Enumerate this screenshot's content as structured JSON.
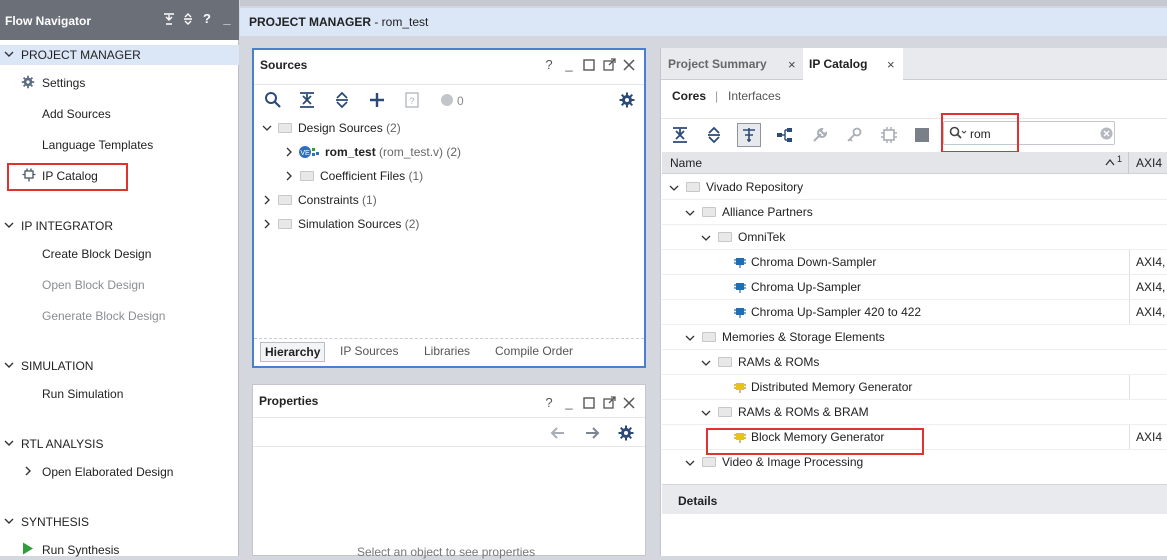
{
  "flow_navigator": {
    "title": "Flow Navigator",
    "header_icons": [
      "collapse-all-icon",
      "expand-all-icon",
      "help-icon",
      "minimize-icon"
    ],
    "sections": {
      "project_manager": {
        "label": "PROJECT MANAGER",
        "items": [
          "Settings",
          "Add Sources",
          "Language Templates",
          "IP Catalog"
        ]
      },
      "ip_integrator": {
        "label": "IP INTEGRATOR",
        "items": [
          "Create Block Design",
          "Open Block Design",
          "Generate Block Design"
        ]
      },
      "simulation": {
        "label": "SIMULATION",
        "items": [
          "Run Simulation"
        ]
      },
      "rtl_analysis": {
        "label": "RTL ANALYSIS",
        "items": [
          "Open Elaborated Design"
        ]
      },
      "synthesis": {
        "label": "SYNTHESIS",
        "items": [
          "Run Synthesis"
        ]
      }
    }
  },
  "banner": {
    "prefix": "PROJECT MANAGER",
    "project": " - rom_test"
  },
  "sources": {
    "title": "Sources",
    "badge_count": "0",
    "tree": {
      "design_sources": "Design Sources",
      "design_sources_count": "(2)",
      "rom_test": "rom_test",
      "rom_test_detail": "(rom_test.v) (2)",
      "coefficient_files": "Coefficient Files",
      "coefficient_files_count": "(1)",
      "constraints": "Constraints",
      "constraints_count": "(1)",
      "simulation_sources": "Simulation Sources",
      "simulation_sources_count": "(2)"
    },
    "bottom_tabs": [
      "Hierarchy",
      "IP Sources",
      "Libraries",
      "Compile Order"
    ]
  },
  "properties": {
    "title": "Properties",
    "placeholder": "Select an object to see properties"
  },
  "ip_catalog": {
    "tabs": [
      "Project Summary",
      "IP Catalog"
    ],
    "subtabs": {
      "cores": "Cores",
      "sep": "|",
      "interfaces": "Interfaces"
    },
    "search_value": "rom",
    "columns": {
      "name": "Name",
      "sort": "1",
      "axi": "AXI4"
    },
    "rows": [
      {
        "label": "Vivado Repository",
        "axi": ""
      },
      {
        "label": "Alliance Partners",
        "axi": ""
      },
      {
        "label": "OmniTek",
        "axi": ""
      },
      {
        "label": "Chroma Down-Sampler",
        "axi": "AXI4, A"
      },
      {
        "label": "Chroma Up-Sampler",
        "axi": "AXI4, A"
      },
      {
        "label": "Chroma Up-Sampler 420 to 422",
        "axi": "AXI4, A"
      },
      {
        "label": "Memories & Storage Elements",
        "axi": ""
      },
      {
        "label": "RAMs & ROMs",
        "axi": ""
      },
      {
        "label": "Distributed Memory Generator",
        "axi": ""
      },
      {
        "label": "RAMs & ROMs & BRAM",
        "axi": ""
      },
      {
        "label": "Block Memory Generator",
        "axi": "AXI4"
      },
      {
        "label": "Video & Image Processing",
        "axi": ""
      }
    ],
    "details_label": "Details"
  },
  "colors": {
    "highlight": "#e0322f",
    "selection_border": "#4a7fd0",
    "chip_blue": "#1e6db5",
    "chip_yellow": "#e6c21a"
  }
}
